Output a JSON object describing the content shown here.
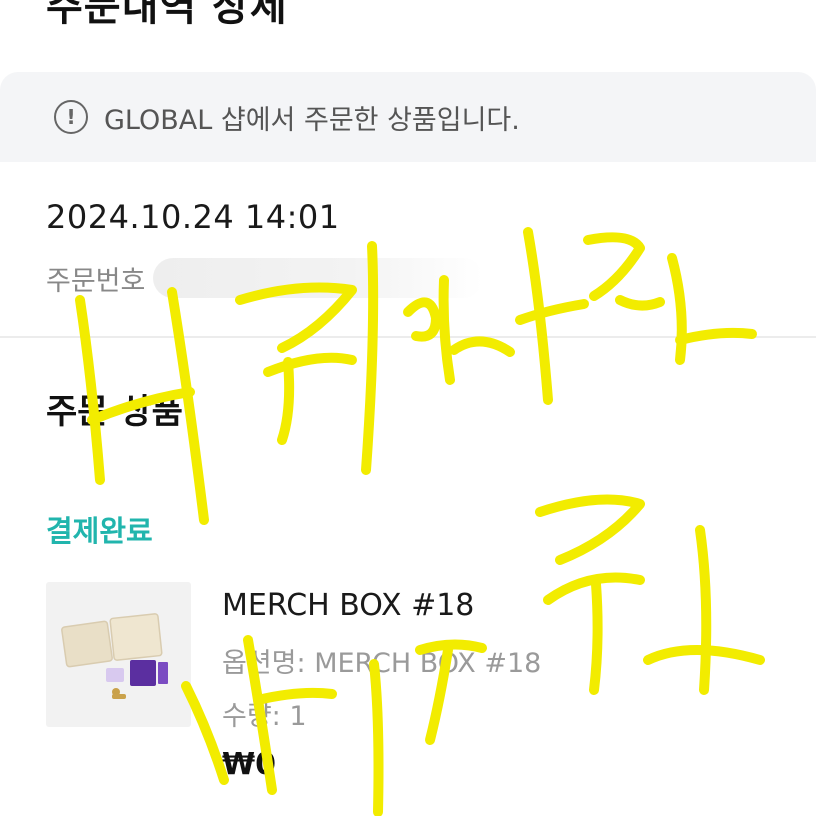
{
  "header": {
    "title": "주문내역 상세"
  },
  "notice": {
    "icon": "exclamation-circle-icon",
    "text": "GLOBAL 샵에서 주문한 상품입니다."
  },
  "order": {
    "datetime": "2024.10.24 14:01",
    "number_label": "주문번호"
  },
  "section": {
    "title": "주문 상품"
  },
  "status": {
    "label": "결제완료",
    "color": "#21b5ad"
  },
  "product": {
    "name": "MERCH BOX #18",
    "option": "옵션명: MERCH BOX #18",
    "quantity": "수량: 1",
    "price": "₩0"
  },
  "annotation": {
    "color": "#f2ec00"
  }
}
